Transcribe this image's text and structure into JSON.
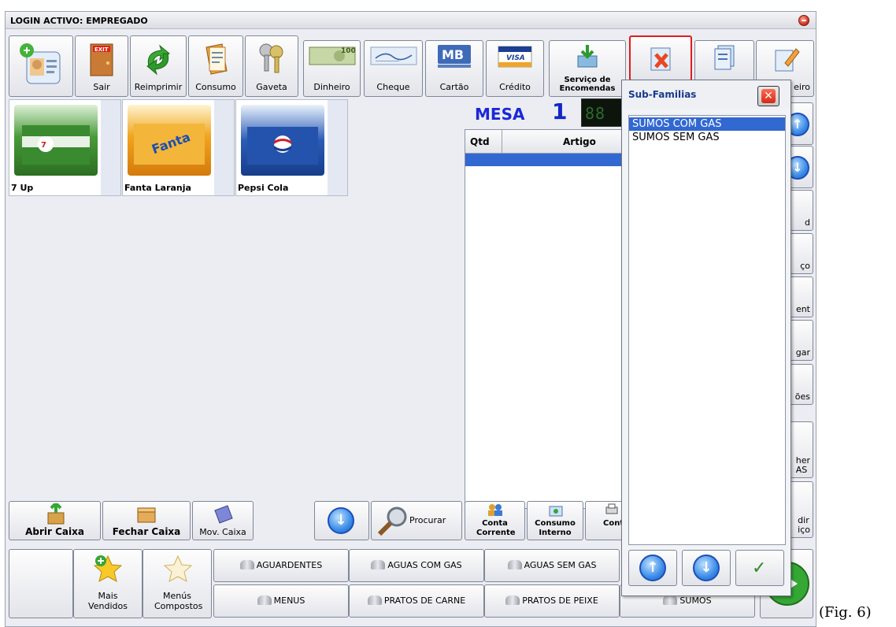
{
  "window": {
    "title": "LOGIN ACTIVO: EMPREGADO"
  },
  "toolbar": {
    "sair": "Sair",
    "reimprimir": "Reimprimir",
    "consumo": "Consumo",
    "gaveta": "Gaveta",
    "dinheiro": "Dinheiro",
    "cheque": "Cheque",
    "cartao": "Cartão",
    "credito": "Crédito",
    "servico": "Serviço de Encomendas",
    "partial_label": "eiro"
  },
  "products": [
    {
      "name": "7 Up"
    },
    {
      "name": "Fanta Laranja"
    },
    {
      "name": "Pepsi Cola"
    }
  ],
  "mesa": {
    "label": "MESA",
    "number": "1"
  },
  "order_table": {
    "col_qty": "Qtd",
    "col_item": "Artigo"
  },
  "popup": {
    "title": "Sub-Familias",
    "items": [
      "SUMOS COM GAS",
      "SUMOS SEM GAS"
    ]
  },
  "right_panel": {
    "r3": "d",
    "r4": "ço",
    "r5": "ent",
    "r6": "gar",
    "r7": "ões",
    "r8": "her\nAS",
    "r9": "dir\niço"
  },
  "bottom": {
    "abrir": "Abrir Caixa",
    "fechar": "Fechar Caixa",
    "mov": "Mov. Caixa",
    "procurar": "Procurar",
    "conta_corrente": "Conta Corrente",
    "consumo_interno": "Consumo Interno",
    "conta_especial": "Cont Espe",
    "mais_vendidos": "Mais Vendidos",
    "menus_compostos": "Menús Compostos"
  },
  "families": {
    "row1": [
      "AGUARDENTES",
      "AGUAS COM GAS",
      "AGUAS SEM GAS"
    ],
    "row2": [
      "MENUS",
      "PRATOS DE CARNE",
      "PRATOS DE PEIXE",
      "SUMOS"
    ]
  },
  "caption": "(Fig. 6)"
}
